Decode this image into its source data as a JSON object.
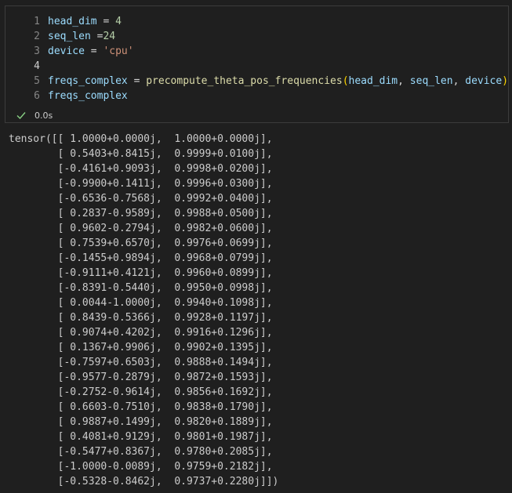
{
  "code_cell": {
    "lines": [
      {
        "num": "1",
        "tokens": [
          {
            "t": "head_dim",
            "c": "var"
          },
          {
            "t": " = ",
            "c": "op"
          },
          {
            "t": "4",
            "c": "num"
          }
        ]
      },
      {
        "num": "2",
        "tokens": [
          {
            "t": "seq_len",
            "c": "var"
          },
          {
            "t": " =",
            "c": "op"
          },
          {
            "t": "24",
            "c": "num"
          }
        ]
      },
      {
        "num": "3",
        "tokens": [
          {
            "t": "device",
            "c": "var"
          },
          {
            "t": " = ",
            "c": "op"
          },
          {
            "t": "'cpu'",
            "c": "str"
          }
        ]
      },
      {
        "num": "4",
        "tokens": []
      },
      {
        "num": "5",
        "tokens": [
          {
            "t": "freqs_complex",
            "c": "var"
          },
          {
            "t": " = ",
            "c": "op"
          },
          {
            "t": "precompute_theta_pos_frequencies",
            "c": "fn"
          },
          {
            "t": "(",
            "c": "paren"
          },
          {
            "t": "head_dim",
            "c": "var"
          },
          {
            "t": ", ",
            "c": "op"
          },
          {
            "t": "seq_len",
            "c": "var"
          },
          {
            "t": ", ",
            "c": "op"
          },
          {
            "t": "device",
            "c": "var"
          },
          {
            "t": ")",
            "c": "paren"
          }
        ]
      },
      {
        "num": "6",
        "tokens": [
          {
            "t": "freqs_complex",
            "c": "var"
          }
        ]
      }
    ],
    "active_line": "4"
  },
  "status": {
    "icon": "check-icon",
    "exec_time": "0.0s"
  },
  "output": {
    "lines": [
      "tensor([[ 1.0000+0.0000j,  1.0000+0.0000j],",
      "        [ 0.5403+0.8415j,  0.9999+0.0100j],",
      "        [-0.4161+0.9093j,  0.9998+0.0200j],",
      "        [-0.9900+0.1411j,  0.9996+0.0300j],",
      "        [-0.6536-0.7568j,  0.9992+0.0400j],",
      "        [ 0.2837-0.9589j,  0.9988+0.0500j],",
      "        [ 0.9602-0.2794j,  0.9982+0.0600j],",
      "        [ 0.7539+0.6570j,  0.9976+0.0699j],",
      "        [-0.1455+0.9894j,  0.9968+0.0799j],",
      "        [-0.9111+0.4121j,  0.9960+0.0899j],",
      "        [-0.8391-0.5440j,  0.9950+0.0998j],",
      "        [ 0.0044-1.0000j,  0.9940+0.1098j],",
      "        [ 0.8439-0.5366j,  0.9928+0.1197j],",
      "        [ 0.9074+0.4202j,  0.9916+0.1296j],",
      "        [ 0.1367+0.9906j,  0.9902+0.1395j],",
      "        [-0.7597+0.6503j,  0.9888+0.1494j],",
      "        [-0.9577-0.2879j,  0.9872+0.1593j],",
      "        [-0.2752-0.9614j,  0.9856+0.1692j],",
      "        [ 0.6603-0.7510j,  0.9838+0.1790j],",
      "        [ 0.9887+0.1499j,  0.9820+0.1889j],",
      "        [ 0.4081+0.9129j,  0.9801+0.1987j],",
      "        [-0.5477+0.8367j,  0.9780+0.2085j],",
      "        [-1.0000-0.0089j,  0.9759+0.2182j],",
      "        [-0.5328-0.8462j,  0.9737+0.2280j]])"
    ]
  },
  "colors": {
    "background": "#1f1f1f",
    "success_check": "#89d185",
    "variable": "#9cdcfe",
    "number": "#b5cea8",
    "string": "#ce9178",
    "function": "#dcdcaa",
    "bracket": "#ffd700",
    "output_text": "#cccccc"
  }
}
